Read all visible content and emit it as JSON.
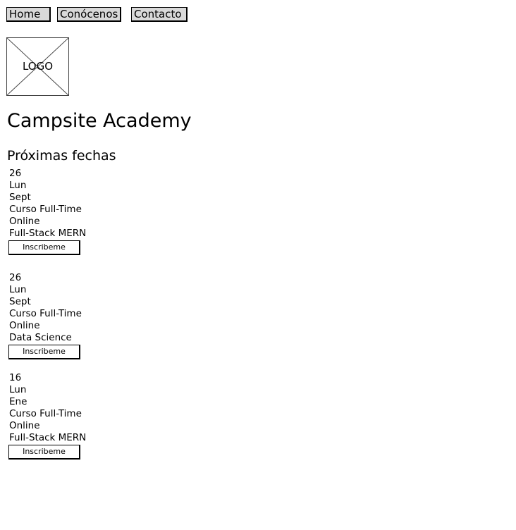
{
  "nav": {
    "items": [
      {
        "label": "Home"
      },
      {
        "label": "Conócenos"
      },
      {
        "label": "Contacto"
      }
    ]
  },
  "logo": {
    "label": "LOGO"
  },
  "page_title": "Campsite Academy",
  "section_title": "Próximas fechas",
  "events": [
    {
      "day": "26",
      "weekday": "Lun",
      "month": "Sept",
      "course_type": "Curso Full-Time",
      "modality": "Online",
      "program": "Full-Stack MERN",
      "button_label": "Inscribeme"
    },
    {
      "day": "26",
      "weekday": "Lun",
      "month": "Sept",
      "course_type": "Curso Full-Time",
      "modality": "Online",
      "program": "Data Science",
      "button_label": "Inscribeme"
    },
    {
      "day": "16",
      "weekday": "Lun",
      "month": "Ene",
      "course_type": "Curso Full-Time",
      "modality": "Online",
      "program": "Full-Stack MERN",
      "button_label": "Inscribeme"
    }
  ]
}
